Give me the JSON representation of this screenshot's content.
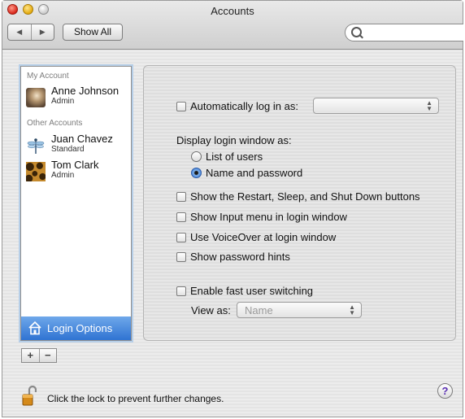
{
  "window": {
    "title": "Accounts"
  },
  "toolbar": {
    "back_icon": "◀",
    "forward_icon": "▶",
    "show_all_label": "Show All",
    "search_placeholder": ""
  },
  "accounts": {
    "my_account_header": "My Account",
    "my_account": {
      "name": "Anne Johnson",
      "role": "Admin",
      "picture": "cat-icon"
    },
    "other_accounts_header": "Other Accounts",
    "others": [
      {
        "name": "Juan Chavez",
        "role": "Standard",
        "picture": "dragonfly-icon"
      },
      {
        "name": "Tom Clark",
        "role": "Admin",
        "picture": "leopard-icon"
      }
    ],
    "login_options_label": "Login Options",
    "add_label": "+",
    "remove_label": "−"
  },
  "login_options": {
    "auto_login_label": "Automatically log in as:",
    "auto_login_checked": false,
    "auto_login_value": "",
    "display_label": "Display login window as:",
    "radio_list_label": "List of users",
    "radio_name_label": "Name and password",
    "selected_display": "Name and password",
    "show_restart_label": "Show the Restart, Sleep, and Shut Down buttons",
    "show_input_menu_label": "Show Input menu in login window",
    "voiceover_label": "Use VoiceOver at login window",
    "password_hints_label": "Show password hints",
    "fast_switch_label": "Enable fast user switching",
    "view_as_label": "View as:",
    "view_as_value": "Name"
  },
  "footer": {
    "lock_text": "Click the lock to prevent further changes.",
    "help_label": "?"
  },
  "colors": {
    "selection": "#2f73d2",
    "help_mark": "#5a2fb3"
  }
}
